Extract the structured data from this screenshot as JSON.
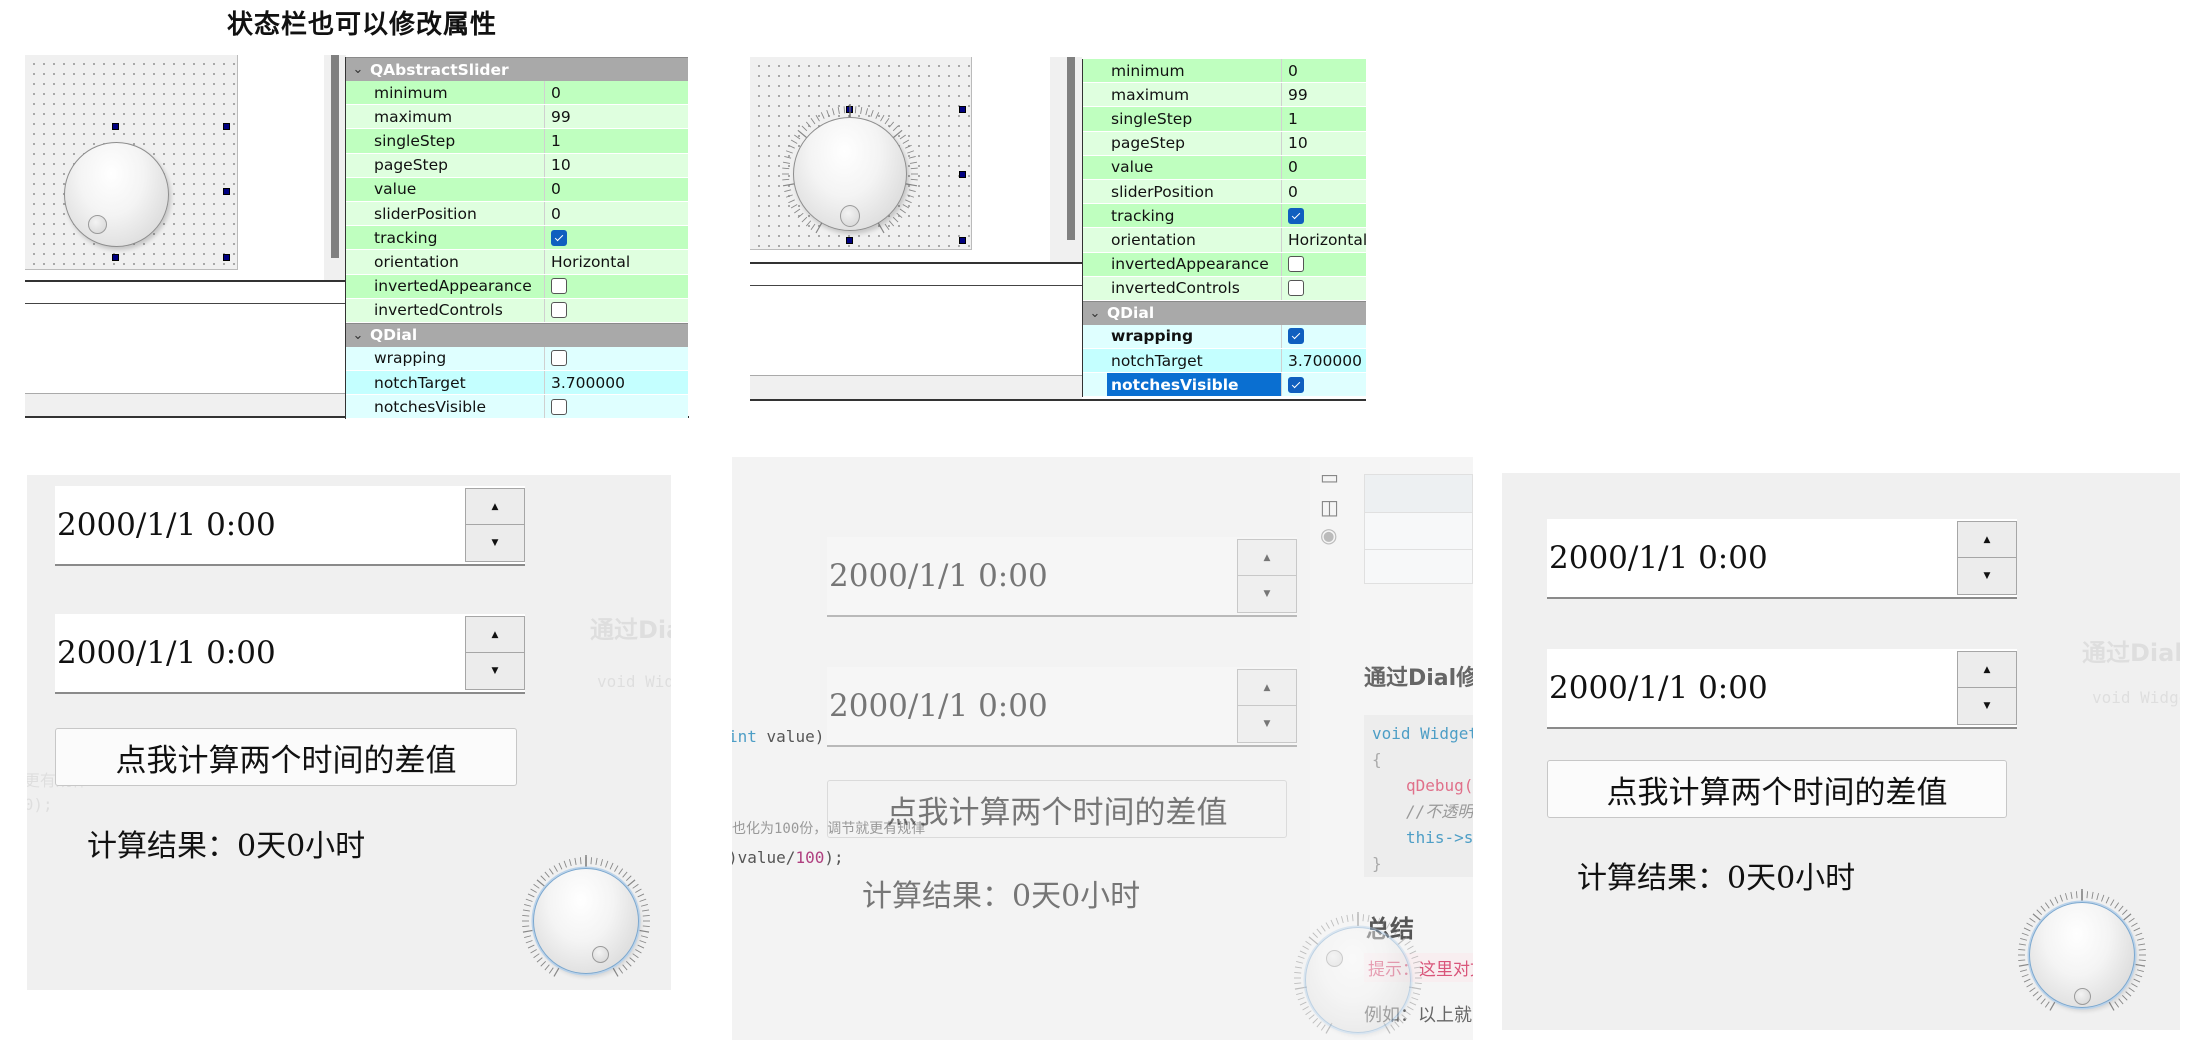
{
  "title": "状态栏也可以修改属性",
  "property_editor_1": {
    "group_abstract_slider": "QAbstractSlider",
    "abstract_slider_props": [
      {
        "name": "minimum",
        "value": "0"
      },
      {
        "name": "maximum",
        "value": "99"
      },
      {
        "name": "singleStep",
        "value": "1"
      },
      {
        "name": "pageStep",
        "value": "10"
      },
      {
        "name": "value",
        "value": "0"
      },
      {
        "name": "sliderPosition",
        "value": "0"
      },
      {
        "name": "tracking",
        "checked": true
      },
      {
        "name": "orientation",
        "value": "Horizontal"
      },
      {
        "name": "invertedAppearance",
        "checked": false
      },
      {
        "name": "invertedControls",
        "checked": false
      }
    ],
    "group_dial": "QDial",
    "dial_props": [
      {
        "name": "wrapping",
        "checked": false
      },
      {
        "name": "notchTarget",
        "value": "3.700000"
      },
      {
        "name": "notchesVisible",
        "checked": false
      }
    ]
  },
  "property_editor_2": {
    "abstract_slider_props": [
      {
        "name": "minimum",
        "value": "0"
      },
      {
        "name": "maximum",
        "value": "99"
      },
      {
        "name": "singleStep",
        "value": "1"
      },
      {
        "name": "pageStep",
        "value": "10"
      },
      {
        "name": "value",
        "value": "0"
      },
      {
        "name": "sliderPosition",
        "value": "0"
      },
      {
        "name": "tracking",
        "checked": true
      },
      {
        "name": "orientation",
        "value": "Horizontal"
      },
      {
        "name": "invertedAppearance",
        "checked": false
      },
      {
        "name": "invertedControls",
        "checked": false
      }
    ],
    "group_dial": "QDial",
    "dial_props": [
      {
        "name": "wrapping",
        "checked": true,
        "bold": true
      },
      {
        "name": "notchTarget",
        "value": "3.700000"
      },
      {
        "name": "notchesVisible",
        "checked": true,
        "selected": true
      }
    ]
  },
  "app_windows": [
    {
      "datetime_1": "2000/1/1 0:00",
      "datetime_2": "2000/1/1 0:00",
      "button": "点我计算两个时间的差值",
      "result": "计算结果：0天0小时"
    },
    {
      "datetime_1": "2000/1/1 0:00",
      "datetime_2": "2000/1/1 0:00",
      "button": "点我计算两个时间的差值",
      "result": "计算结果：0天0小时"
    },
    {
      "datetime_1": "2000/1/1 0:00",
      "datetime_2": "2000/1/1 0:00",
      "button": "点我计算两个时间的差值",
      "result": "计算结果：0天0小时"
    }
  ],
  "spin_up": "▲",
  "spin_down": "▼",
  "background_doc": {
    "heading": "通过Dial修",
    "code_lines": [
      "void Widget",
      "{",
      "qDebug(",
      "//不透明",
      "this->s",
      "}"
    ],
    "summary_heading": "总结",
    "tip": "提示：这里对文",
    "example": "例如：以上就",
    "left_snippets": [
      "int value)",
      "也化为100份，调节就更有规律",
      ")value/100);"
    ]
  },
  "dial_value": 0,
  "dial_max": 99
}
